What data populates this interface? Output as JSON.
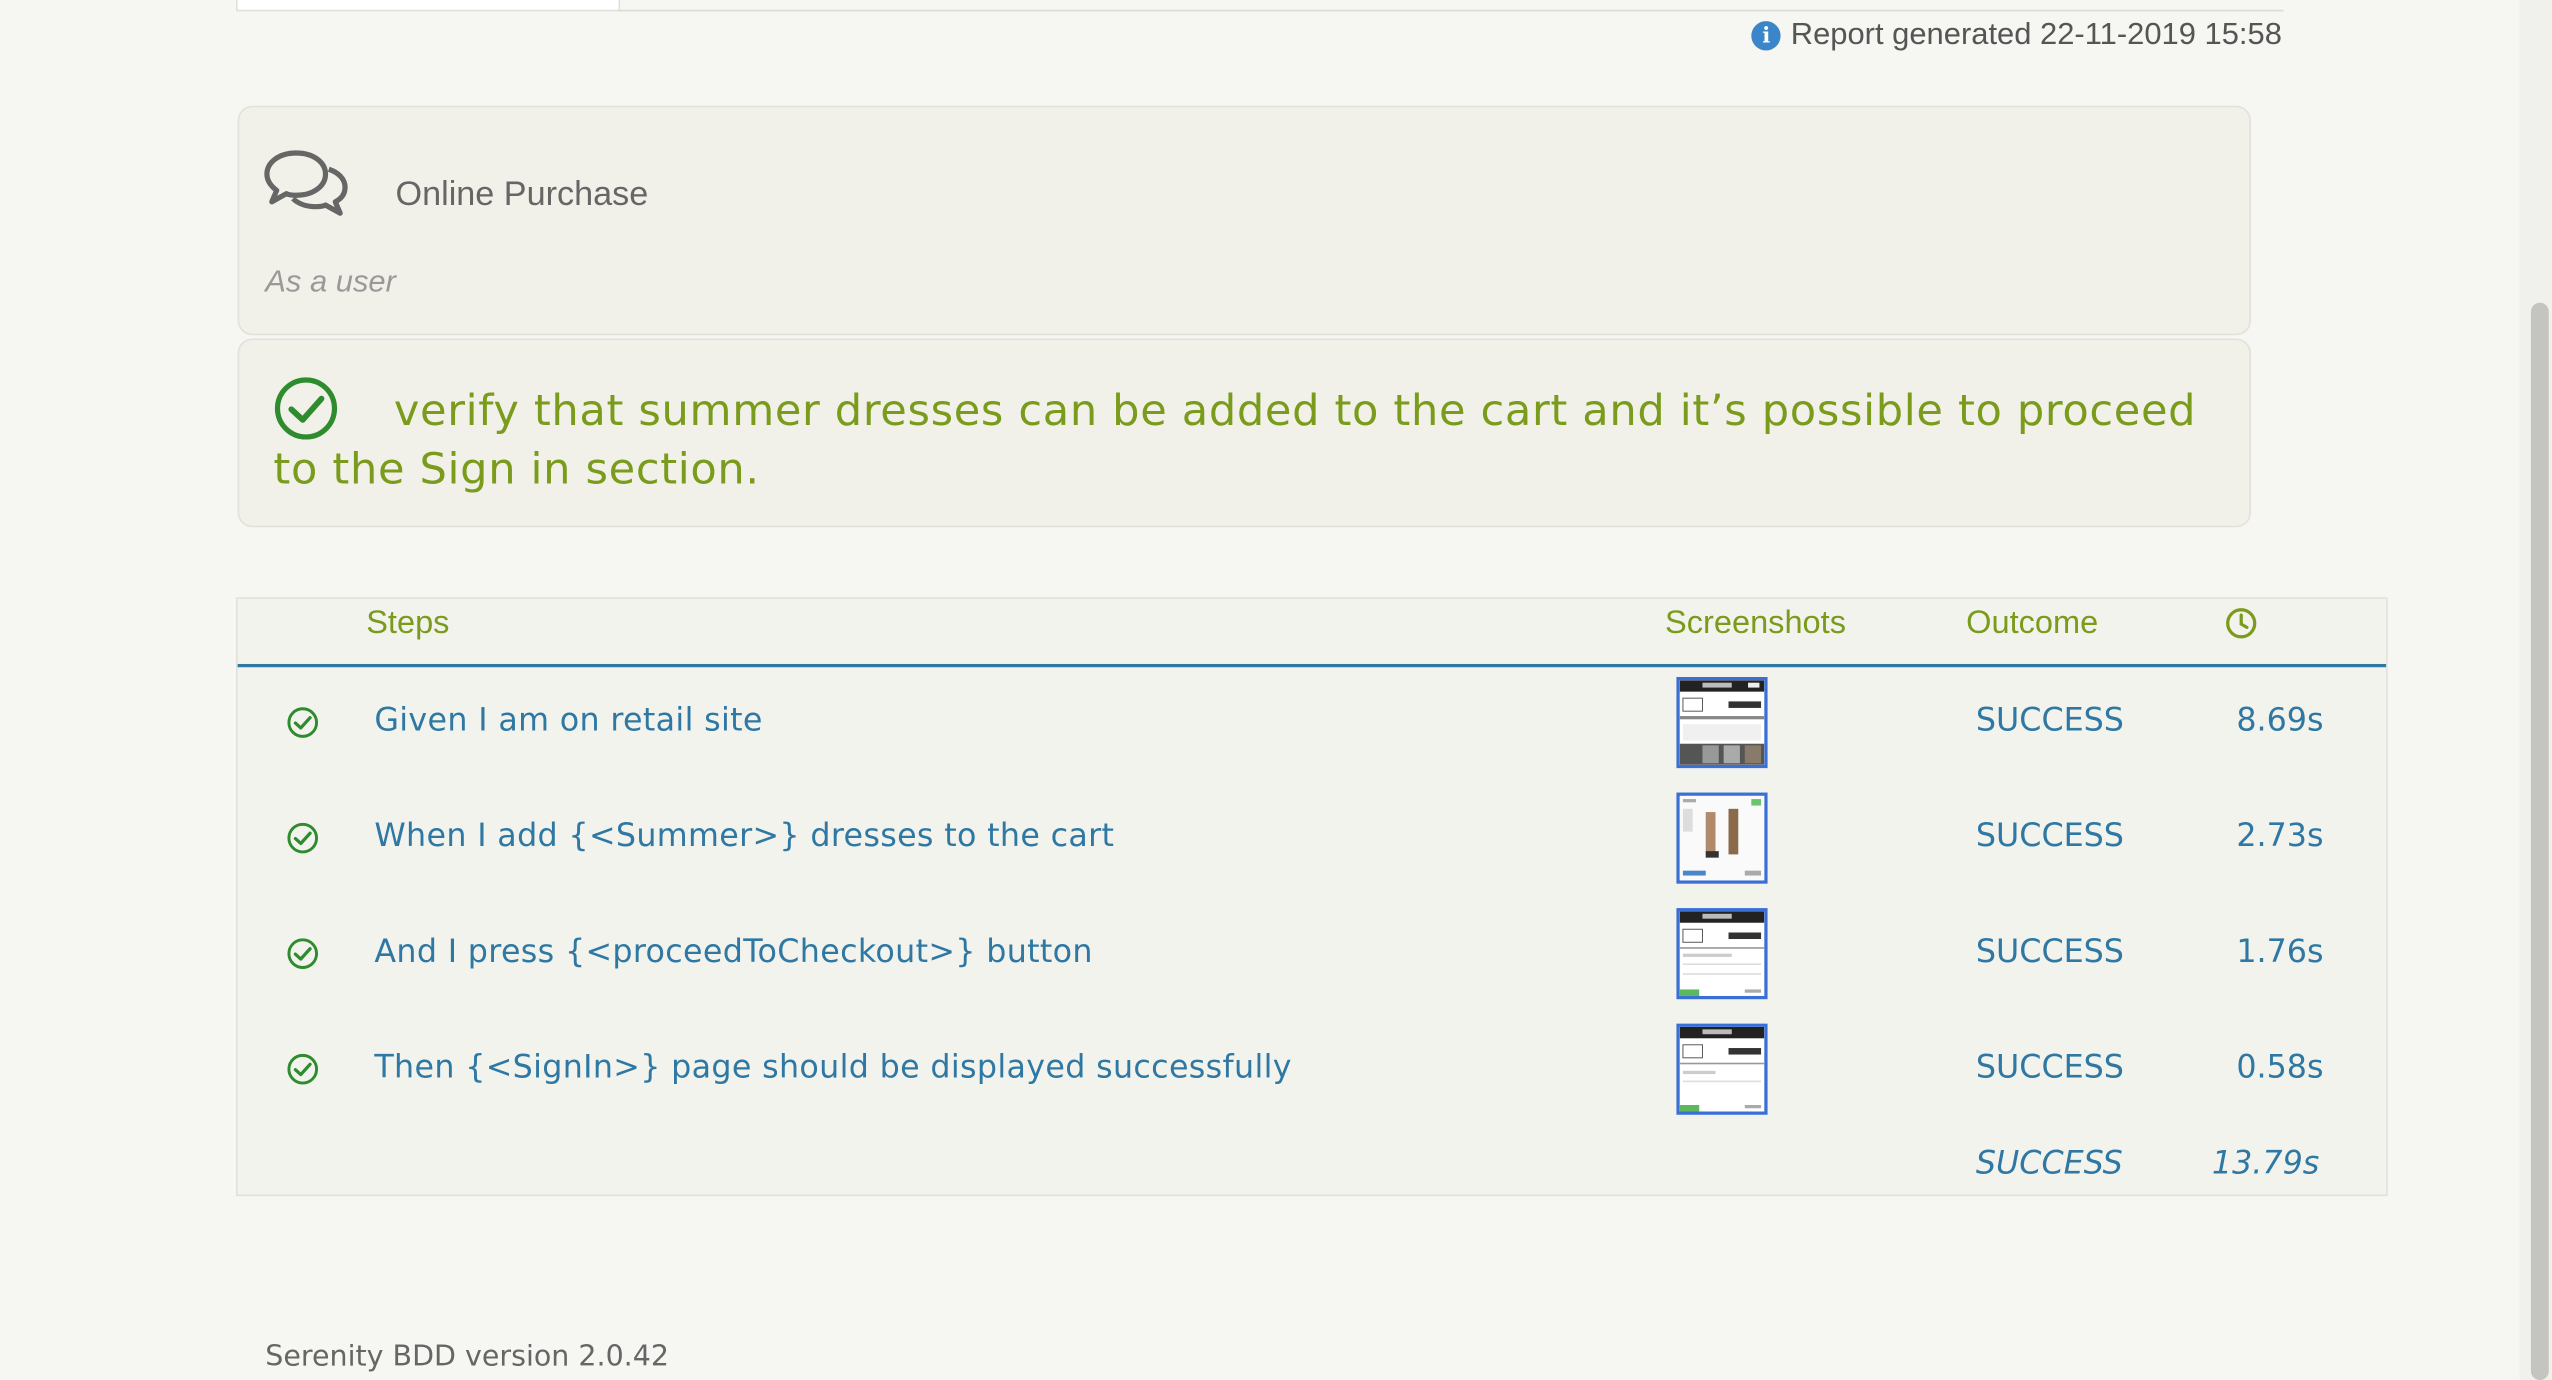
{
  "report_generated": "Report generated 22-11-2019 15:58",
  "feature": {
    "title": "Online Purchase",
    "narrative": "As a user"
  },
  "scenario": {
    "title": "verify that summer dresses can be added to the cart and it’s possible to proceed to the Sign in section."
  },
  "steps_table": {
    "headers": {
      "steps": "Steps",
      "screenshots": "Screenshots",
      "outcome": "Outcome"
    },
    "rows": [
      {
        "description": "Given I am on retail site",
        "outcome": "SUCCESS",
        "duration": "8.69s"
      },
      {
        "description": "When I add {<Summer>} dresses to the cart",
        "outcome": "SUCCESS",
        "duration": "2.73s"
      },
      {
        "description": "And I press {<proceedToCheckout>} button",
        "outcome": "SUCCESS",
        "duration": "1.76s"
      },
      {
        "description": "Then {<SignIn>} page should be displayed successfully",
        "outcome": "SUCCESS",
        "duration": "0.58s"
      }
    ],
    "total": {
      "outcome": "SUCCESS",
      "duration": "13.79s"
    }
  },
  "footer": "Serenity BDD version 2.0.42",
  "colors": {
    "accent_green": "#7a9b1c",
    "link_blue": "#2e78a3",
    "success_check": "#2e8b2e"
  },
  "icons": [
    "info-icon",
    "chat-bubbles-icon",
    "check-circle-icon",
    "clock-icon"
  ]
}
